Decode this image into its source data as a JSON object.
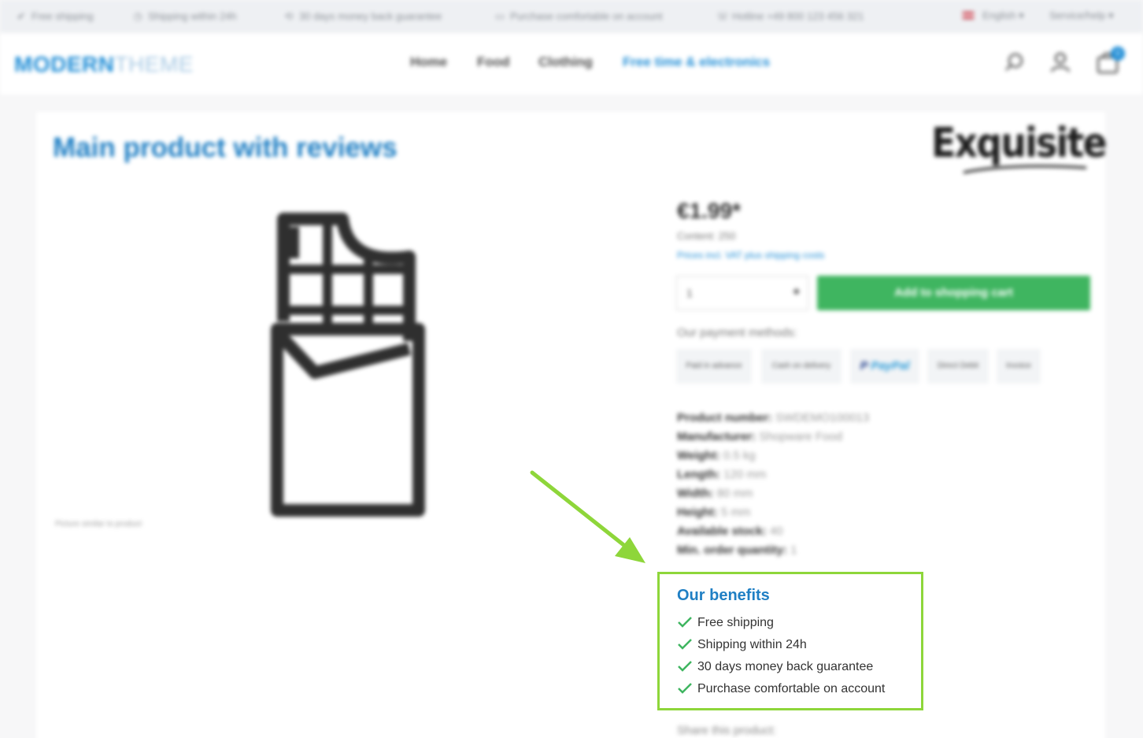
{
  "topbar": {
    "usps": [
      {
        "icon": "check-icon",
        "label": "Free shipping"
      },
      {
        "icon": "clock-icon",
        "label": "Shipping within 24h"
      },
      {
        "icon": "money-back-icon",
        "label": "30 days money back guarantee"
      },
      {
        "icon": "invoice-icon",
        "label": "Purchase comfortable on account"
      },
      {
        "icon": "phone-icon",
        "label": "Hotline +49 800 123 456 321"
      }
    ],
    "language": "English",
    "service": "Service/help"
  },
  "header": {
    "logo_bold": "MODERN",
    "logo_light": "THEME",
    "nav": [
      {
        "label": "Home",
        "active": false
      },
      {
        "label": "Food",
        "active": false
      },
      {
        "label": "Clothing",
        "active": false
      },
      {
        "label": "Free time & electronics",
        "active": true
      }
    ],
    "cart_count": "0"
  },
  "product": {
    "title": "Main product with reviews",
    "brand": "Exquisite",
    "image_caption": "Picture similar to product",
    "price": "€1.99*",
    "content": "Content: 250",
    "price_note": "Prices incl. VAT plus shipping costs",
    "quantity": "1",
    "add_to_cart": "Add to shopping cart",
    "payment_label": "Our payment methods:",
    "payment_methods": [
      "Paid in advance",
      "Cash on delivery",
      "PayPal",
      "Direct Debit",
      "Invoice"
    ],
    "specs": [
      {
        "label": "Product number:",
        "value": "SWDEMO100013"
      },
      {
        "label": "Manufacturer:",
        "value": "Shopware Food"
      },
      {
        "label": "Weight:",
        "value": "0.5 kg"
      },
      {
        "label": "Length:",
        "value": "120 mm"
      },
      {
        "label": "Width:",
        "value": "80 mm"
      },
      {
        "label": "Height:",
        "value": "5 mm"
      },
      {
        "label": "Available stock:",
        "value": "40"
      },
      {
        "label": "Min. order quantity:",
        "value": "1"
      }
    ],
    "share_label": "Share this product:"
  },
  "benefits": {
    "title": "Our benefits",
    "items": [
      "Free shipping",
      "Shipping within 24h",
      "30 days money back guarantee",
      "Purchase comfortable on account"
    ]
  },
  "colors": {
    "accent": "#1f8dd6",
    "cart_button": "#3fb560",
    "highlight": "#8ed63a"
  }
}
